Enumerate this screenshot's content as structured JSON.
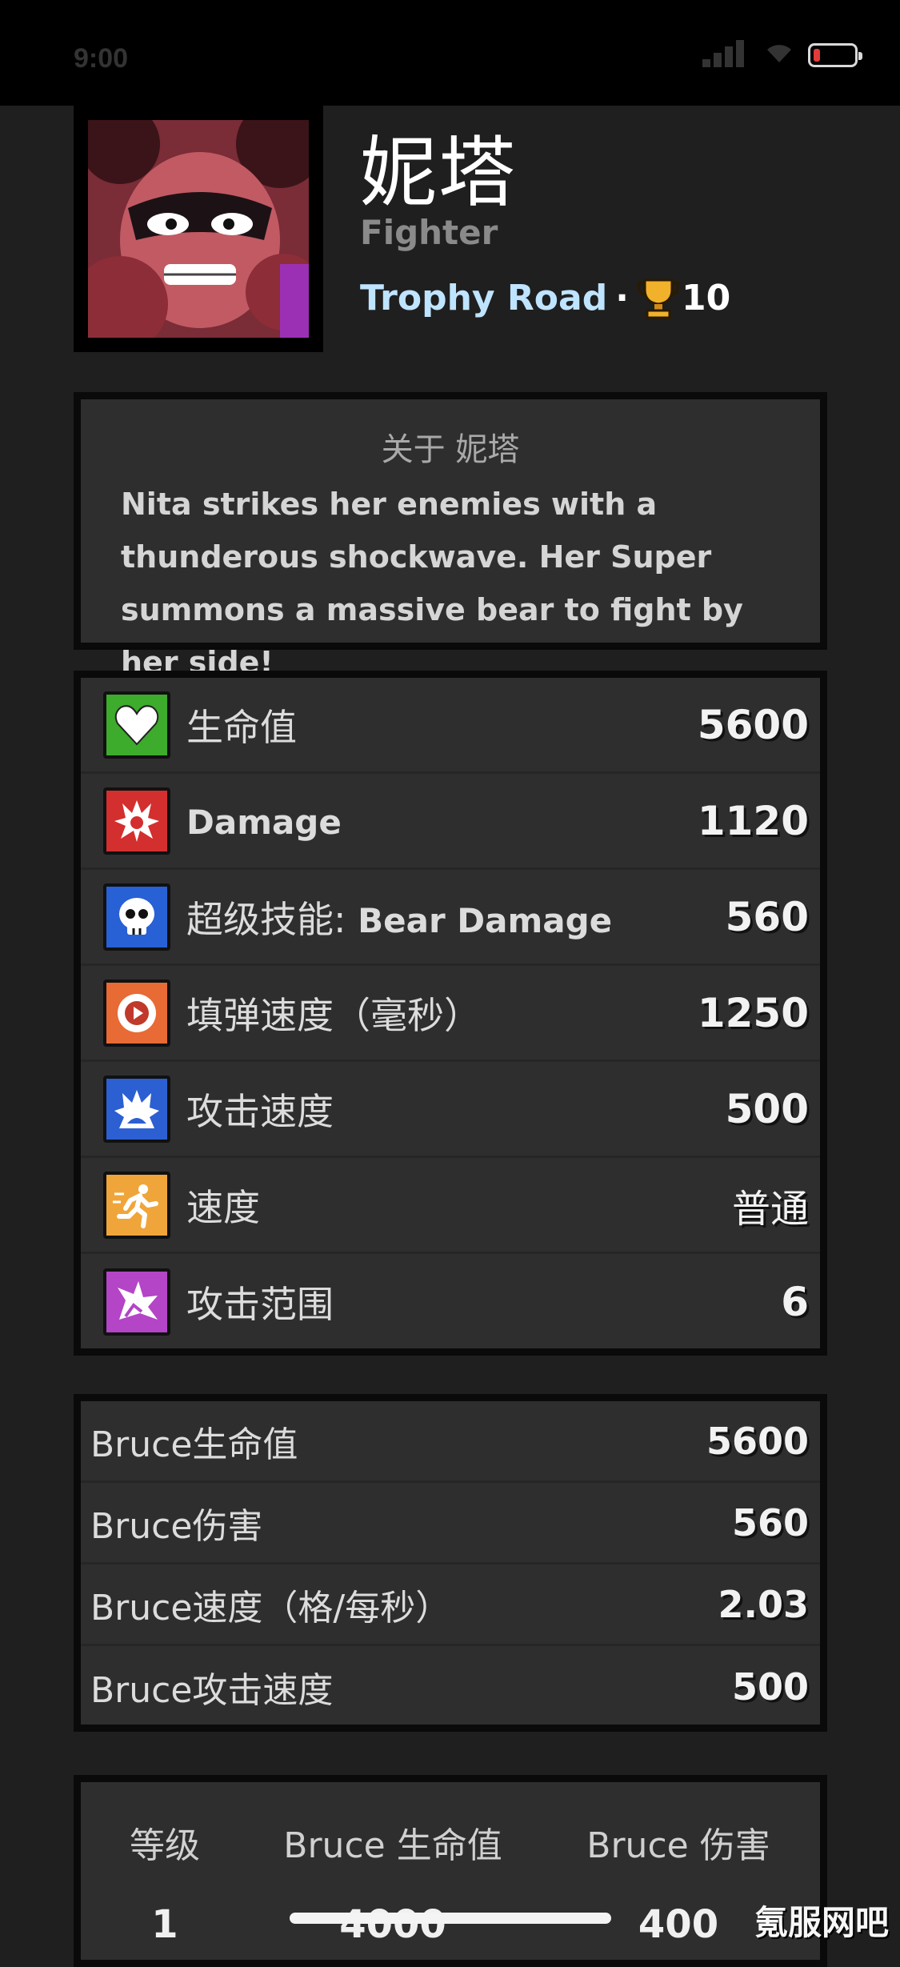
{
  "status": {
    "time": "9:00"
  },
  "hero": {
    "name": "妮塔",
    "class": "Fighter",
    "unlock": "Trophy Road",
    "separator": "·",
    "trophies": "10"
  },
  "about": {
    "title": "关于 妮塔",
    "text": "Nita strikes her enemies with a thunderous shockwave. Her Super summons a massive bear to fight by her side!"
  },
  "stats": [
    {
      "icon": "heart-icon",
      "label": "生命值",
      "value": "5600",
      "color": "#3dab2c"
    },
    {
      "icon": "damage-burst-icon",
      "label": "Damage",
      "value": "1120",
      "color": "#d32f2f"
    },
    {
      "icon": "skull-icon",
      "label": "超级技能:",
      "label_bold": "Bear Damage",
      "value": "560",
      "color": "#2860d6"
    },
    {
      "icon": "reload-clock-icon",
      "label": "填弹速度（毫秒）",
      "value": "1250",
      "color": "#e86a35"
    },
    {
      "icon": "attack-speed-icon",
      "label": "攻击速度",
      "value": "500",
      "color": "#2c5fd1"
    },
    {
      "icon": "running-man-icon",
      "label": "速度",
      "value": "普通",
      "color": "#f0a53a"
    },
    {
      "icon": "range-burst-icon",
      "label": "攻击范围",
      "value": "6",
      "color": "#b345c6"
    }
  ],
  "bruce": [
    {
      "label": "Bruce生命值",
      "value": "5600"
    },
    {
      "label": "Bruce伤害",
      "value": "560"
    },
    {
      "label": "Bruce速度（格/每秒）",
      "value": "2.03"
    },
    {
      "label": "Bruce攻击速度",
      "value": "500"
    }
  ],
  "levels": {
    "headers": [
      "等级",
      "Bruce 生命值",
      "Bruce 伤害"
    ],
    "first_row": [
      "1",
      "4000",
      "400"
    ]
  },
  "watermark": "氪服网吧"
}
